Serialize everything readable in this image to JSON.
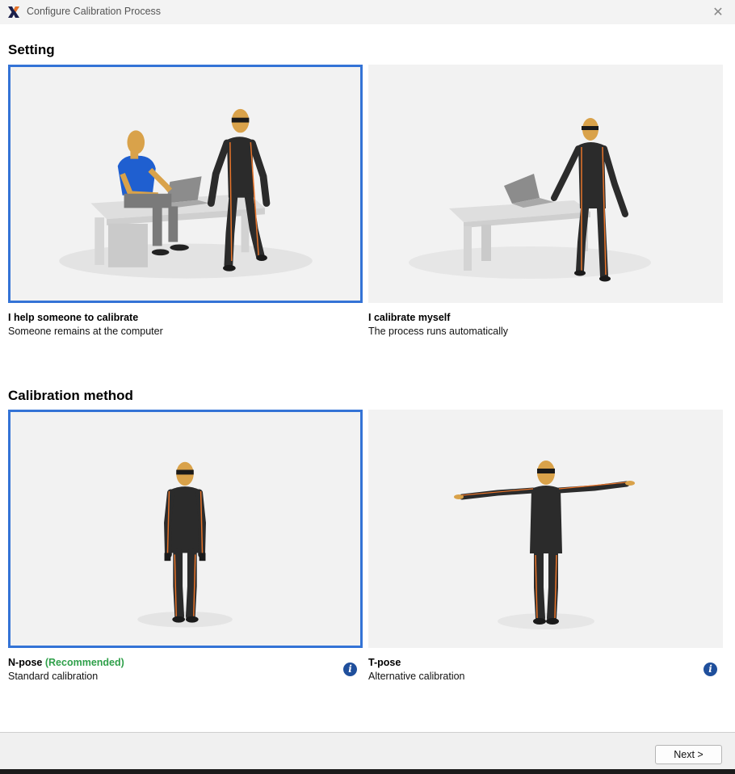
{
  "window": {
    "title": "Configure Calibration Process",
    "close_glyph": "✕",
    "logo_icon": "xsens-x-logo"
  },
  "setting": {
    "heading": "Setting",
    "options": [
      {
        "title": "I help someone to calibrate",
        "subtitle": "Someone remains at the computer",
        "selected": true
      },
      {
        "title": "I calibrate myself",
        "subtitle": "The process runs automatically",
        "selected": false
      }
    ]
  },
  "method": {
    "heading": "Calibration method",
    "options": [
      {
        "title": "N-pose",
        "badge": "(Recommended)",
        "subtitle": "Standard calibration",
        "selected": true,
        "info_glyph": "i"
      },
      {
        "title": "T-pose",
        "subtitle": "Alternative calibration",
        "selected": false,
        "info_glyph": "i"
      }
    ]
  },
  "footer": {
    "next_label": "Next >"
  },
  "colors": {
    "selection_border": "#3473d6",
    "recommended": "#2fa04a",
    "suit": "#2b2b2b",
    "suit_stripe": "#e8742a",
    "skin": "#d9a24a",
    "shirt": "#1f5fd0",
    "info_icon": "#1f4f9c"
  }
}
